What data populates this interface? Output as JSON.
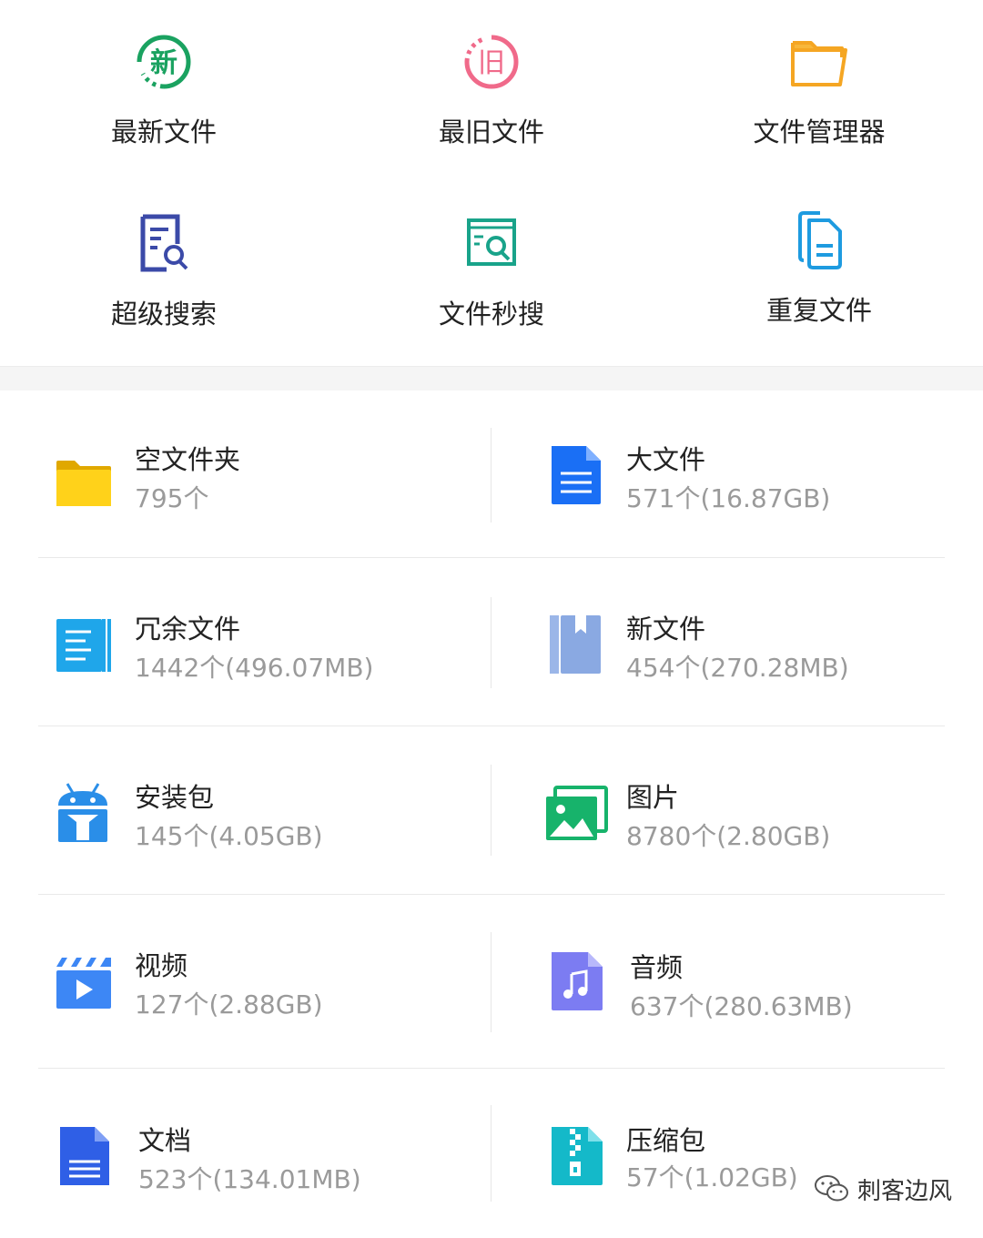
{
  "tools": [
    {
      "label": "最新文件",
      "icon": "new-badge-icon",
      "glyph": "新",
      "color": "#1aa260"
    },
    {
      "label": "最旧文件",
      "icon": "old-badge-icon",
      "glyph": "旧",
      "color": "#f06a8a"
    },
    {
      "label": "文件管理器",
      "icon": "folder-icon",
      "color": "#f5a623"
    },
    {
      "label": "超级搜索",
      "icon": "doc-search-icon",
      "color": "#3b4aa8"
    },
    {
      "label": "文件秒搜",
      "icon": "quick-search-icon",
      "color": "#19a38a"
    },
    {
      "label": "重复文件",
      "icon": "duplicate-files-icon",
      "color": "#1e9be0"
    }
  ],
  "categories": [
    {
      "name": "空文件夹",
      "info": "795个",
      "icon": "yellow-folder-icon"
    },
    {
      "name": "大文件",
      "info": "571个(16.87GB)",
      "icon": "blue-document-icon"
    },
    {
      "name": "冗余文件",
      "info": "1442个(496.07MB)",
      "icon": "redundant-files-icon"
    },
    {
      "name": "新文件",
      "info": "454个(270.28MB)",
      "icon": "bookmark-file-icon"
    },
    {
      "name": "安装包",
      "info": "145个(4.05GB)",
      "icon": "android-package-icon"
    },
    {
      "name": "图片",
      "info": "8780个(2.80GB)",
      "icon": "gallery-icon"
    },
    {
      "name": "视频",
      "info": "127个(2.88GB)",
      "icon": "video-clapper-icon"
    },
    {
      "name": "音频",
      "info": "637个(280.63MB)",
      "icon": "audio-file-icon"
    },
    {
      "name": "文档",
      "info": "523个(134.01MB)",
      "icon": "document-icon"
    },
    {
      "name": "压缩包",
      "info": "57个(1.02GB)",
      "icon": "zip-archive-icon"
    }
  ],
  "watermark": {
    "text": "刺客边风",
    "icon": "wechat-icon"
  }
}
